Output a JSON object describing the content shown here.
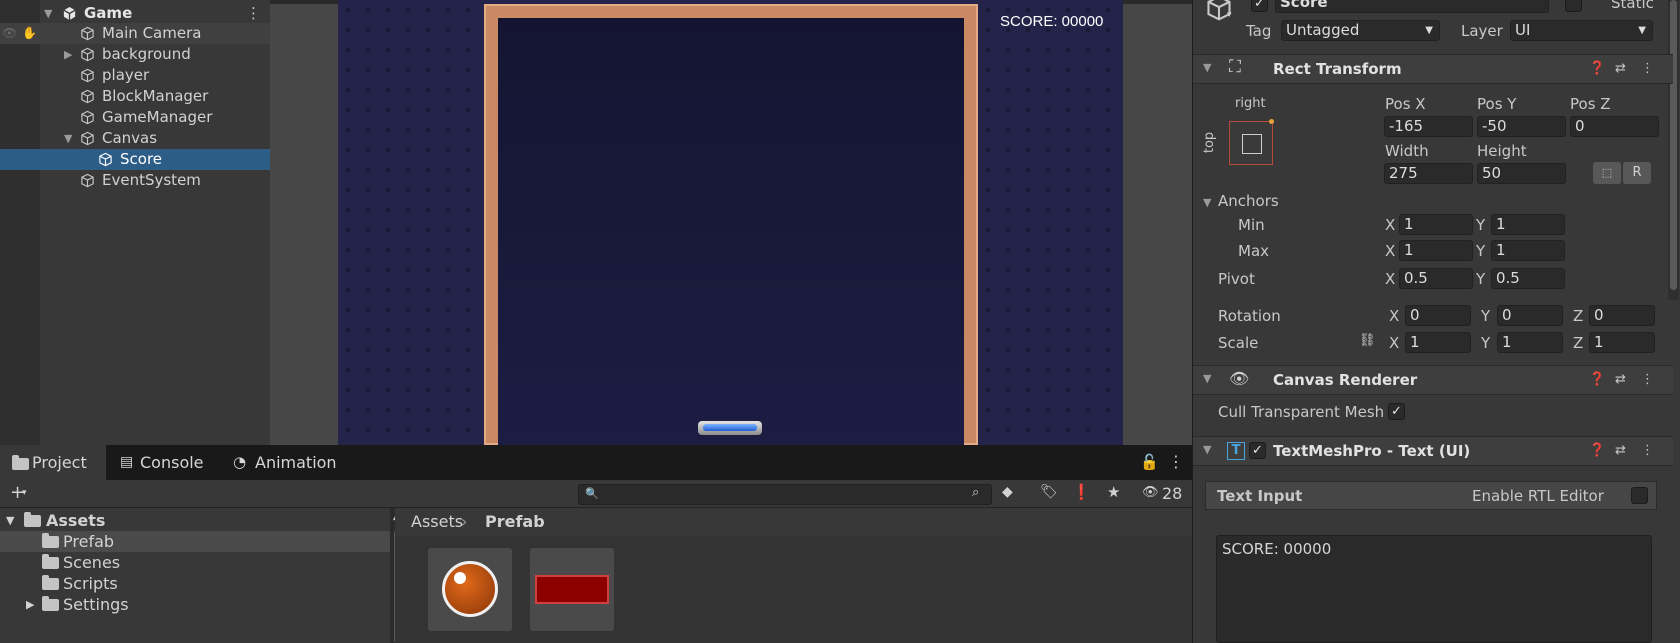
{
  "hierarchy": {
    "root": "Game",
    "items": [
      {
        "label": "Main Camera"
      },
      {
        "label": "background"
      },
      {
        "label": "player"
      },
      {
        "label": "BlockManager"
      },
      {
        "label": "GameManager"
      },
      {
        "label": "Canvas"
      },
      {
        "label": "Score"
      },
      {
        "label": "EventSystem"
      }
    ]
  },
  "scene": {
    "score_text": "SCORE: 00000"
  },
  "bottom": {
    "tabs": [
      {
        "label": "Project"
      },
      {
        "label": "Console"
      },
      {
        "label": "Animation"
      }
    ],
    "hidden_count": "28",
    "search_placeholder": "",
    "tree": [
      {
        "label": "Assets"
      },
      {
        "label": "Prefab"
      },
      {
        "label": "Scenes"
      },
      {
        "label": "Scripts"
      },
      {
        "label": "Settings"
      }
    ],
    "breadcrumb": {
      "root": "Assets",
      "current": "Prefab"
    }
  },
  "inspector": {
    "object_name": "Score",
    "static_label": "Static",
    "tag_label": "Tag",
    "tag_value": "Untagged",
    "layer_label": "Layer",
    "layer_value": "UI",
    "rect_transform": {
      "title": "Rect Transform",
      "anchor_h": "right",
      "anchor_v": "top",
      "pos_x_label": "Pos X",
      "pos_x": "-165",
      "pos_y_label": "Pos Y",
      "pos_y": "-50",
      "pos_z_label": "Pos Z",
      "pos_z": "0",
      "width_label": "Width",
      "width": "275",
      "height_label": "Height",
      "height": "50",
      "r_button": "R",
      "anchors_label": "Anchors",
      "min_label": "Min",
      "min_x": "1",
      "min_y": "1",
      "max_label": "Max",
      "max_x": "1",
      "max_y": "1",
      "pivot_label": "Pivot",
      "pivot_x": "0.5",
      "pivot_y": "0.5",
      "rotation_label": "Rotation",
      "rot_x": "0",
      "rot_y": "0",
      "rot_z": "0",
      "scale_label": "Scale",
      "scale_x": "1",
      "scale_y": "1",
      "scale_z": "1",
      "x": "X",
      "y": "Y",
      "z": "Z"
    },
    "canvas_renderer": {
      "title": "Canvas Renderer",
      "cull_label": "Cull Transparent Mesh"
    },
    "tmp": {
      "title": "TextMeshPro - Text (UI)",
      "text_input_label": "Text Input",
      "rtl_label": "Enable RTL Editor",
      "text_value": "SCORE: 00000"
    }
  }
}
